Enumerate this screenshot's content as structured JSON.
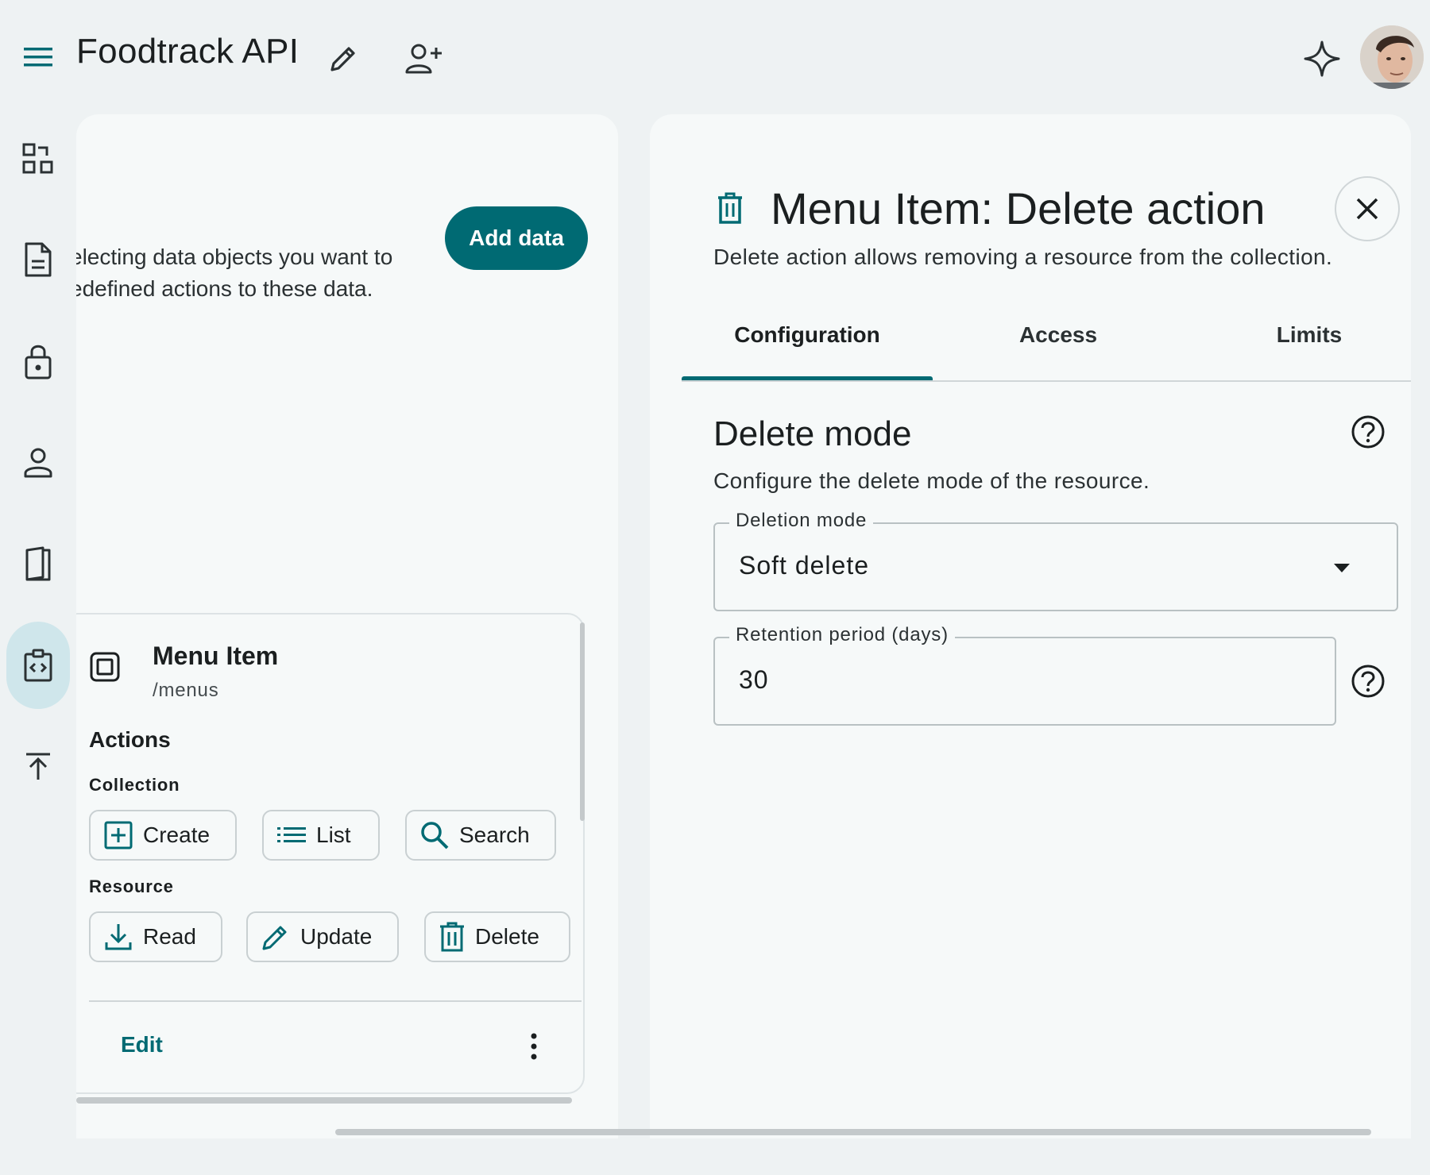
{
  "header": {
    "title": "Foodtrack API",
    "icons": [
      "menu-icon",
      "pencil-icon",
      "person-add-icon",
      "sparkle-icon",
      "avatar"
    ]
  },
  "rail": {
    "items": [
      {
        "name": "dashboard-icon"
      },
      {
        "name": "document-icon"
      },
      {
        "name": "lock-icon"
      },
      {
        "name": "person-icon"
      },
      {
        "name": "book-icon"
      },
      {
        "name": "api-icon",
        "active": true
      },
      {
        "name": "upload-icon"
      }
    ]
  },
  "left": {
    "intro_line1": "electing data objects you want to",
    "intro_line2": "edefined actions to these data.",
    "add_data_label": "Add data",
    "card": {
      "title": "Menu Item",
      "path": "/menus",
      "actions_title": "Actions",
      "collection_title": "Collection",
      "collection_actions": [
        "Create",
        "List",
        "Search"
      ],
      "resource_title": "Resource",
      "resource_actions": [
        "Read",
        "Update",
        "Delete"
      ],
      "edit_label": "Edit"
    }
  },
  "right": {
    "title": "Menu Item: Delete action",
    "description": "Delete action allows removing a resource from the collection.",
    "tabs": [
      {
        "label": "Configuration",
        "active": true
      },
      {
        "label": "Access"
      },
      {
        "label": "Limits"
      }
    ],
    "section": {
      "title": "Delete mode",
      "subtitle": "Configure the delete mode of the resource.",
      "deletion_mode_label": "Deletion mode",
      "deletion_mode_value": "Soft delete",
      "retention_label": "Retention period (days)",
      "retention_value": "30"
    }
  },
  "colors": {
    "accent": "#006a73",
    "background": "#eef2f3",
    "surface": "#f6f9f9",
    "active_rail": "#cfe6eb"
  }
}
